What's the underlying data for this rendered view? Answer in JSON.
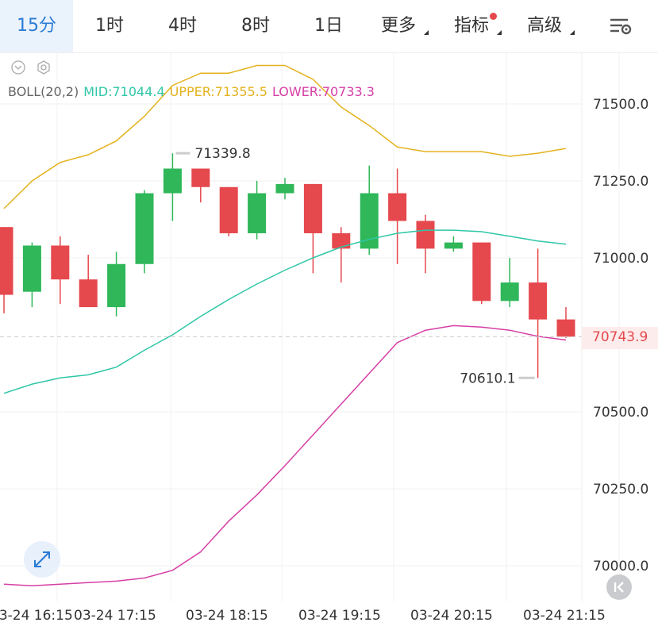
{
  "tabs": [
    {
      "label": "15分",
      "active": true
    },
    {
      "label": "1时"
    },
    {
      "label": "4时"
    },
    {
      "label": "8时"
    },
    {
      "label": "1日"
    },
    {
      "label": "更多",
      "dropdown": true
    },
    {
      "label": "指标",
      "dropdown": true,
      "badge": true
    },
    {
      "label": "高级",
      "dropdown": true
    }
  ],
  "icons": {
    "settings": "chart-settings-icon",
    "collapse": "chevron-down-circle-icon",
    "indicator_settings": "gear-icon",
    "expand": "expand-arrows-icon",
    "back_to_latest": "double-chevron-left-icon"
  },
  "legend": {
    "name": "BOLL(20,2)",
    "mid": "MID:71044.4",
    "upper": "UPPER:71355.5",
    "lower": "LOWER:70733.3"
  },
  "colors": {
    "up": "#2fb75a",
    "down": "#e5484d",
    "mid": "#2ec7a7",
    "upper": "#e4b21d",
    "lower": "#d63fa6",
    "accent": "#2a7bd6"
  },
  "current_price": "70743.9",
  "chart_data": {
    "type": "candlestick",
    "y_axis": {
      "ticks": [
        "71500.0",
        "71250.0",
        "71000.0",
        "70500.0",
        "70250.0",
        "70000.0"
      ],
      "range": [
        69930,
        71650
      ]
    },
    "x_axis": {
      "ticks": [
        "03-24 16:15",
        "03-24 17:15",
        "03-24 18:15",
        "03-24 19:15",
        "03-24 20:15",
        "03-24 21:15"
      ]
    },
    "high_label": "71339.8",
    "low_label": "70610.1",
    "candles": [
      {
        "o": 71100,
        "h": 71100,
        "l": 70820,
        "c": 70880
      },
      {
        "o": 70890,
        "h": 71050,
        "l": 70840,
        "c": 71040
      },
      {
        "o": 71040,
        "h": 71070,
        "l": 70850,
        "c": 70930
      },
      {
        "o": 70930,
        "h": 71010,
        "l": 70850,
        "c": 70840
      },
      {
        "o": 70840,
        "h": 71020,
        "l": 70810,
        "c": 70980
      },
      {
        "o": 70980,
        "h": 71220,
        "l": 70950,
        "c": 71210
      },
      {
        "o": 71210,
        "h": 71339.8,
        "l": 71120,
        "c": 71290
      },
      {
        "o": 71290,
        "h": 71290,
        "l": 71180,
        "c": 71230
      },
      {
        "o": 71230,
        "h": 71230,
        "l": 71070,
        "c": 71080
      },
      {
        "o": 71080,
        "h": 71250,
        "l": 71060,
        "c": 71210
      },
      {
        "o": 71210,
        "h": 71260,
        "l": 71190,
        "c": 71240
      },
      {
        "o": 71240,
        "h": 71240,
        "l": 70950,
        "c": 71080
      },
      {
        "o": 71080,
        "h": 71100,
        "l": 70920,
        "c": 71030
      },
      {
        "o": 71030,
        "h": 71300,
        "l": 71010,
        "c": 71210
      },
      {
        "o": 71210,
        "h": 71290,
        "l": 70980,
        "c": 71120
      },
      {
        "o": 71120,
        "h": 71140,
        "l": 70950,
        "c": 71030
      },
      {
        "o": 71030,
        "h": 71070,
        "l": 71020,
        "c": 71050
      },
      {
        "o": 71050,
        "h": 71050,
        "l": 70850,
        "c": 70860
      },
      {
        "o": 70860,
        "h": 71000,
        "l": 70840,
        "c": 70920
      },
      {
        "o": 70920,
        "h": 71030,
        "l": 70610.1,
        "c": 70800
      },
      {
        "o": 70800,
        "h": 70840,
        "l": 70740,
        "c": 70743.9
      }
    ],
    "boll": {
      "upper": [
        71160,
        71250,
        71310,
        71335,
        71380,
        71460,
        71560,
        71600,
        71600,
        71625,
        71625,
        71580,
        71490,
        71430,
        71360,
        71345,
        71345,
        71345,
        71330,
        71340,
        71355.5
      ],
      "mid": [
        70560,
        70590,
        70610,
        70620,
        70645,
        70700,
        70750,
        70810,
        70865,
        70915,
        70960,
        71000,
        71035,
        71060,
        71080,
        71090,
        71090,
        71085,
        71070,
        71055,
        71044.4
      ],
      "lower": [
        69940,
        69935,
        69940,
        69945,
        69950,
        69960,
        69985,
        70045,
        70145,
        70230,
        70325,
        70425,
        70525,
        70625,
        70725,
        70765,
        70780,
        70775,
        70765,
        70745,
        70733.3
      ]
    }
  }
}
